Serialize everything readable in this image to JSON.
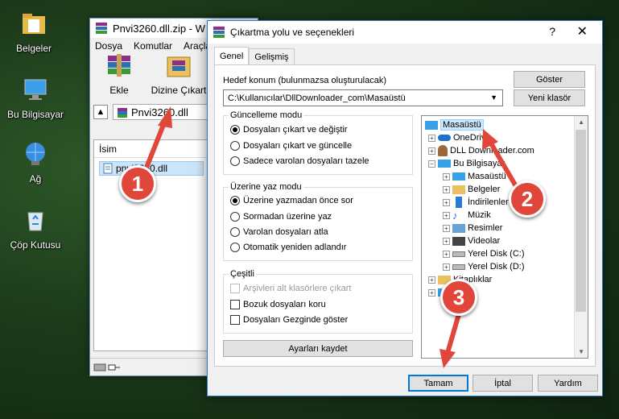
{
  "desktop": {
    "icons": [
      {
        "label": "Belgeler"
      },
      {
        "label": "Bu Bilgisayar"
      },
      {
        "label": "Ağ"
      },
      {
        "label": "Çöp Kutusu"
      }
    ]
  },
  "winrar": {
    "title": "Pnvi3260.dll.zip - W",
    "menu": [
      "Dosya",
      "Komutlar",
      "Araçla"
    ],
    "toolbar": {
      "add_label": "Ekle",
      "extract_label": "Dizine Çıkart"
    },
    "path_text": "Pnvi3260.dll",
    "list_header": "İsim",
    "file_name": "pnvi3260.dll"
  },
  "dialog": {
    "title": "Çıkartma yolu ve seçenekleri",
    "help_glyph": "?",
    "close_glyph": "✕",
    "tabs": [
      {
        "label": "Genel"
      },
      {
        "label": "Gelişmiş"
      }
    ],
    "dest_label": "Hedef konum (bulunmazsa oluşturulacak)",
    "dest_value": "C:\\Kullanıcılar\\DllDownloader_com\\Masaüstü",
    "show_button": "Göster",
    "new_folder_button": "Yeni klasör",
    "update_mode": {
      "title": "Güncelleme modu",
      "options": [
        {
          "label": "Dosyaları çıkart ve değiştir",
          "selected": true
        },
        {
          "label": "Dosyaları çıkart ve güncelle",
          "selected": false
        },
        {
          "label": "Sadece varolan dosyaları tazele",
          "selected": false
        }
      ]
    },
    "overwrite_mode": {
      "title": "Üzerine yaz modu",
      "options": [
        {
          "label": "Üzerine yazmadan önce sor",
          "selected": true
        },
        {
          "label": "Sormadan üzerine yaz",
          "selected": false
        },
        {
          "label": "Varolan dosyaları atla",
          "selected": false
        },
        {
          "label": "Otomatik yeniden adlandır",
          "selected": false
        }
      ]
    },
    "misc": {
      "title": "Çeşitli",
      "options": [
        {
          "label": "Arşivleri alt klasörlere çıkart",
          "checked": false,
          "disabled": true
        },
        {
          "label": "Bozuk dosyaları koru",
          "checked": false,
          "disabled": false
        },
        {
          "label": "Dosyaları Gezginde göster",
          "checked": false,
          "disabled": false
        }
      ]
    },
    "save_settings_button": "Ayarları kaydet",
    "tree": [
      {
        "label": "Masaüstü",
        "selected": true
      },
      {
        "label": "OneDrive"
      },
      {
        "label": "DLL Downloader.com"
      },
      {
        "label": "Bu Bilgisayar"
      },
      {
        "label": "Masaüstü"
      },
      {
        "label": "Belgeler"
      },
      {
        "label": "İndirilenler"
      },
      {
        "label": "Müzik"
      },
      {
        "label": "Resimler"
      },
      {
        "label": "Videolar"
      },
      {
        "label": "Yerel Disk (C:)"
      },
      {
        "label": "Yerel Disk (D:)"
      },
      {
        "label": "Kitaplıklar"
      },
      {
        "label": "Ağ"
      }
    ],
    "ok_button": "Tamam",
    "cancel_button": "İptal",
    "help_button": "Yardım"
  },
  "callouts": [
    "1",
    "2",
    "3"
  ],
  "colors": {
    "arrow": "#e0463a",
    "selection": "#cce8ff",
    "accent": "#0078d7"
  }
}
